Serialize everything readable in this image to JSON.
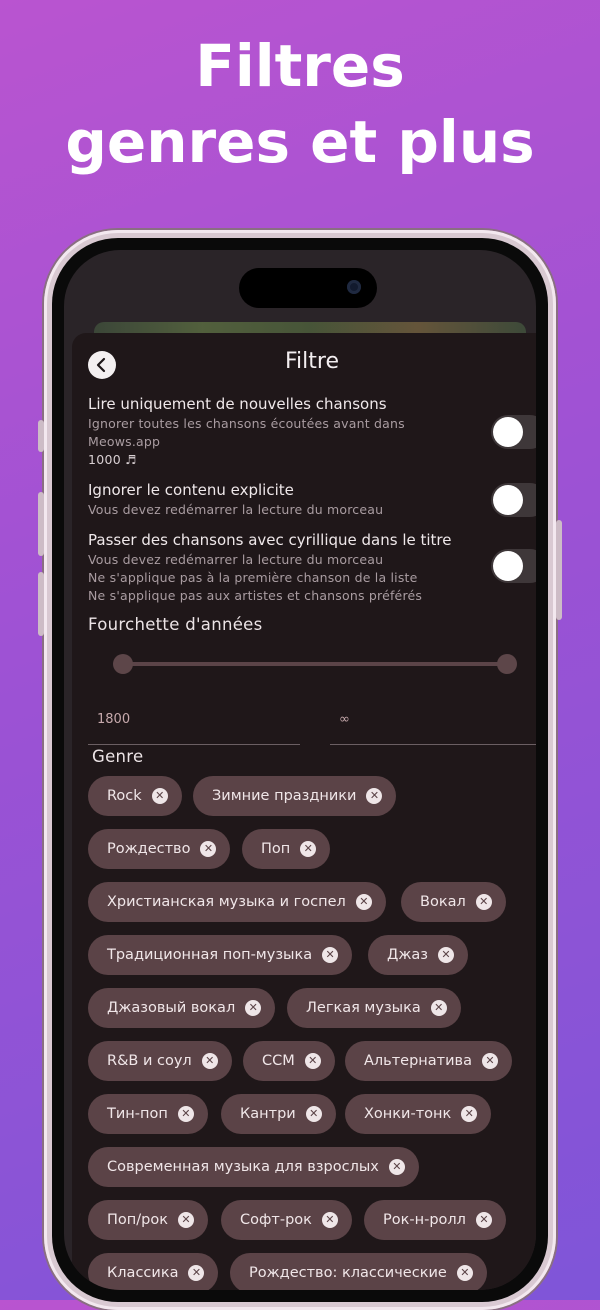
{
  "promo": {
    "line1": "Filtres",
    "line2": "genres et plus"
  },
  "header": {
    "title": "Filtre",
    "back_icon": "chevron-left-icon"
  },
  "options": [
    {
      "title": "Lire uniquement de nouvelles chansons",
      "subtitle_lines": [
        "Ignorer toutes les chansons  écoutées avant dans",
        "Meows.app"
      ],
      "count": "1000 ♬",
      "enabled": false
    },
    {
      "title": "Ignorer le contenu explicite",
      "subtitle_lines": [
        "Vous devez redémarrer la lecture du morceau"
      ],
      "enabled": false
    },
    {
      "title": "Passer des chansons avec cyrillique dans le titre",
      "subtitle_lines": [
        "Vous devez redémarrer la lecture du morceau",
        "Ne s'applique pas à la première chanson de la liste",
        "Ne s'applique pas aux artistes et chansons préférés"
      ],
      "enabled": false
    }
  ],
  "years": {
    "label": "Fourchette d'années",
    "from": "1800",
    "to": "∞",
    "range_fraction": [
      0.0,
      1.0
    ]
  },
  "genre": {
    "label": "Genre",
    "chips": [
      "Rock",
      "Зимние праздники",
      "Рождество",
      "Поп",
      "Христианская музыка и госпел",
      "Вокал",
      "Традиционная поп-музыка",
      "Джаз",
      "Джазовый вокал",
      "Легкая музыка",
      "R&B и соул",
      "CCM",
      "Альтернатива",
      "Тин-поп",
      "Кантри",
      "Хонки-тонк",
      "Современная музыка для взрослых",
      "Поп/рок",
      "Софт-рок",
      "Рок-н-ролл",
      "Классика",
      "Рождество: классические"
    ]
  },
  "colors": {
    "background_start": "#b954d0",
    "background_end": "#7f55d8",
    "sheet": "#1f1719",
    "chip": "#5b4347"
  }
}
